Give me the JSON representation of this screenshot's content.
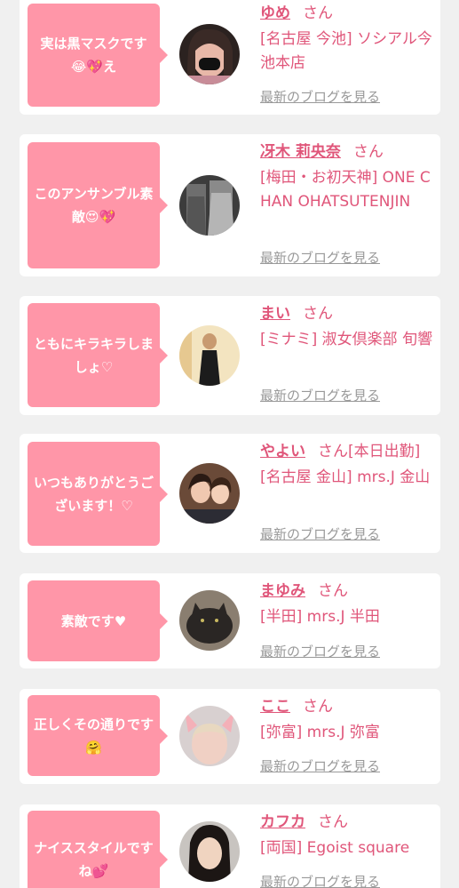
{
  "colors": {
    "accent_pink": "#ff96a8",
    "name_pink": "#e0567a",
    "link_gray": "#999999",
    "background": "#f0f0f0",
    "card": "#ffffff"
  },
  "san_label": "さん",
  "cards": [
    {
      "comment": "実は黒マスクです😂💖え",
      "name": "ゆめ",
      "status": "",
      "shop": "[名古屋 今池] ソシアル今池本店",
      "blog_link": "最新のブログを見る",
      "avatar_icon": "avatar-photo-black-mask"
    },
    {
      "comment": "このアンサンブル素敵😍💖",
      "name": "冴木 莉央奈",
      "status": "",
      "shop": "[梅田・お初天神] ONE CHAN OHATSUTENJIN",
      "blog_link": "最新のブログを見る",
      "avatar_icon": "avatar-photo-ensemble"
    },
    {
      "comment": "ともにキラキラしましょ♡",
      "name": "まい",
      "status": "",
      "shop": "[ミナミ] 淑女倶楽部 旬響",
      "blog_link": "最新のブログを見る",
      "avatar_icon": "avatar-photo-dress"
    },
    {
      "comment": "いつもありがとうございます！♡",
      "name": "やよい",
      "status": "[本日出勤]",
      "shop": "[名古屋 金山] mrs.J 金山",
      "blog_link": "最新のブログを見る",
      "avatar_icon": "avatar-photo-two-women"
    },
    {
      "comment": "素敵です♥",
      "name": "まゆみ",
      "status": "",
      "shop": "[半田] mrs.J 半田",
      "blog_link": "最新のブログを見る",
      "avatar_icon": "avatar-photo-cat"
    },
    {
      "comment": "正しくその通りです🤗",
      "name": "ここ",
      "status": "",
      "shop": "[弥富] mrs.J 弥富",
      "blog_link": "最新のブログを見る",
      "avatar_icon": "avatar-photo-bunny-ears"
    },
    {
      "comment": "ナイススタイルですね💕",
      "name": "カフカ",
      "status": "",
      "shop": "[両国] Egoist square",
      "blog_link": "最新のブログを見る",
      "avatar_icon": "avatar-photo-woman"
    }
  ]
}
